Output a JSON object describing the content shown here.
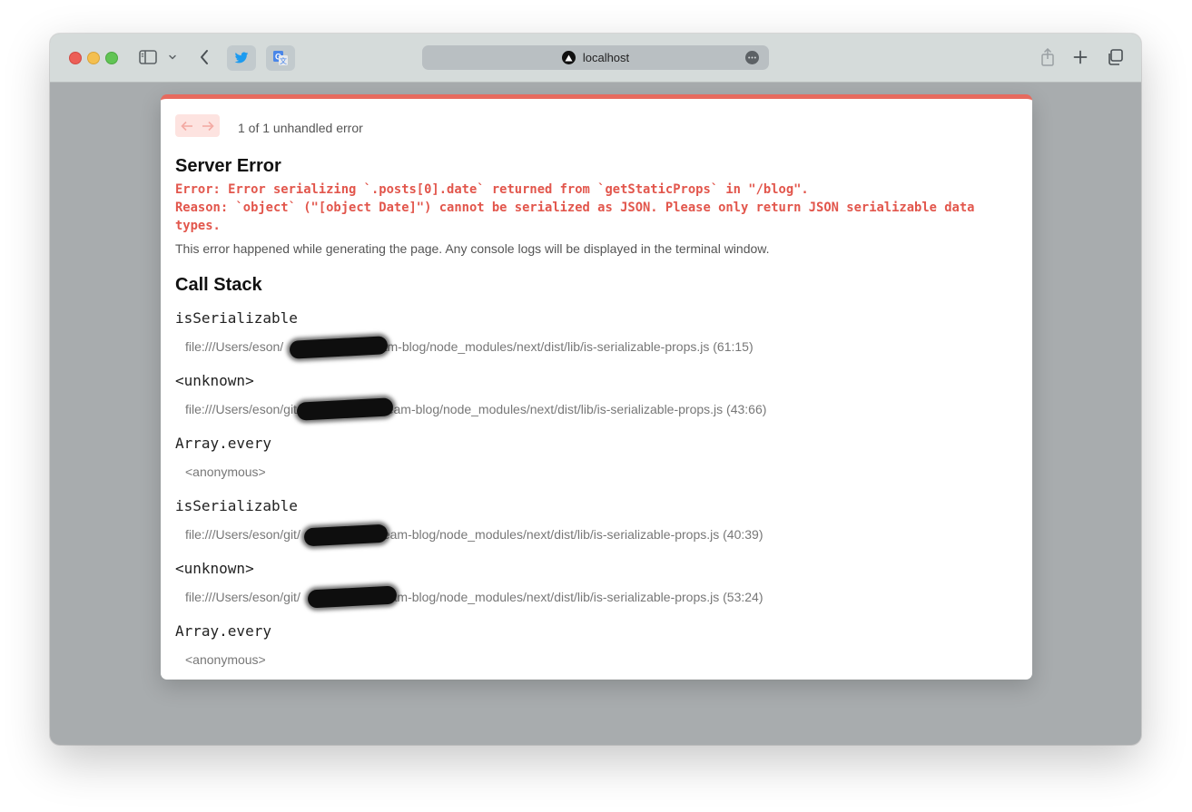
{
  "browser": {
    "url": "localhost",
    "icons": [
      "sidebar-icon",
      "chevron-down-icon",
      "back-icon",
      "twitter-icon",
      "translate-icon",
      "share-icon",
      "plus-icon",
      "tabs-icon",
      "more-icon"
    ]
  },
  "overlay": {
    "error_count": "1 of 1 unhandled error",
    "title": "Server Error",
    "error_lines": [
      "Error: Error serializing `.posts[0].date` returned from `getStaticProps` in \"/blog\".",
      "Reason: `object` (\"[object Date]\") cannot be serialized as JSON. Please only return JSON serializable data",
      "types."
    ],
    "description": "This error happened while generating the page. Any console logs will be displayed in the terminal window.",
    "call_stack_title": "Call Stack",
    "frames": [
      {
        "fn": "isSerializable",
        "location": "file:///Users/eson/                front-team-blog/node_modules/next/dist/lib/is-serializable-props.js (61:15)"
      },
      {
        "fn": "<unknown>",
        "location": "file:///Users/eson/git/               front-team-blog/node_modules/next/dist/lib/is-serializable-props.js (43:66)"
      },
      {
        "fn": "Array.every",
        "location": "<anonymous>"
      },
      {
        "fn": "isSerializable",
        "location": "file:///Users/eson/git/              front-team-blog/node_modules/next/dist/lib/is-serializable-props.js (40:39)"
      },
      {
        "fn": "<unknown>",
        "location": "file:///Users/eson/git/              front-team-blog/node_modules/next/dist/lib/is-serializable-props.js (53:24)"
      },
      {
        "fn": "Array.every",
        "location": "<anonymous>"
      }
    ],
    "accent_color": "#e76a5e",
    "error_text_color": "#e2564c"
  }
}
